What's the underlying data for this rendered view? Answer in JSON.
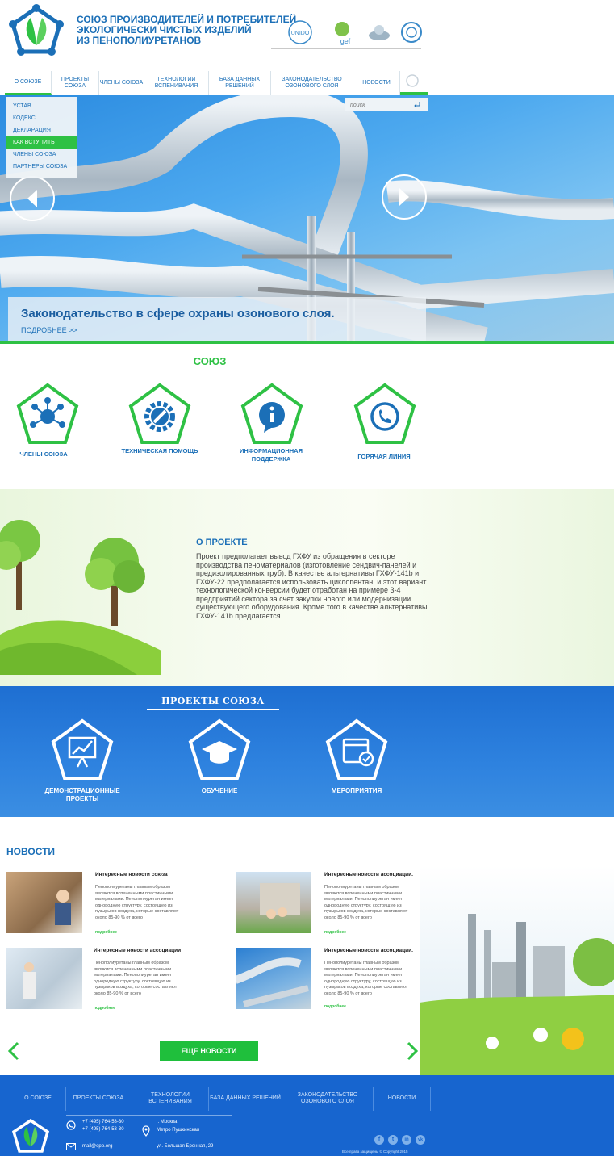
{
  "header": {
    "org_name_lines": [
      "СОЮЗ ПРОИЗВОДИТЕЛЕЙ И ПОТРЕБИТЕЛЕЙ",
      "ЭКОЛОГИЧЕСКИ ЧИСТЫХ ИЗДЕЛИЙ",
      "ИЗ ПЕНОПОЛИУРЕТАНОВ"
    ],
    "partners": [
      {
        "text": "UNIDO"
      },
      {
        "text": "gef"
      },
      {
        "text": ""
      },
      {
        "text": ""
      }
    ]
  },
  "nav": {
    "items": [
      {
        "label": "О СОЮЗЕ",
        "active": true
      },
      {
        "label": "ПРОЕКТЫ СОЮЗА"
      },
      {
        "label": "ЧЛЕНЫ СОЮЗА"
      },
      {
        "label": "ТЕХНОЛОГИИ ВСПЕНИВАНИЯ"
      },
      {
        "label": "БАЗА ДАННЫХ РЕШЕНИЙ"
      },
      {
        "label": "ЗАКОНОДАТЕЛЬСТВО ОЗОНОВОГО СЛОЯ"
      },
      {
        "label": "НОВОСТИ"
      }
    ],
    "dropdown": [
      "УСТАВ",
      "КОДЕКС",
      "ДЕКЛАРАЦИЯ",
      "КАК ВСТУПИТЬ",
      "ЧЛЕНЫ СОЮЗА",
      "ПАРТНЕРЫ СОЮЗА"
    ],
    "dropdown_active": "КАК ВСТУПИТЬ",
    "search_placeholder": "поиск"
  },
  "hero": {
    "caption_title": "Законодательство в сфере охраны озонового слоя.",
    "caption_more": "ПОДРОБНЕЕ >>"
  },
  "union": {
    "title": "СОЮЗ",
    "items": [
      {
        "label": "ЧЛЕНЫ СОЮЗА",
        "icon": "network-icon"
      },
      {
        "label": "ТЕХНИЧЕСКАЯ ПОМОЩЬ",
        "icon": "gear-wrench-icon"
      },
      {
        "label": "ИНФОРМАЦИОННАЯ ПОДДЕРЖКА",
        "icon": "info-icon"
      },
      {
        "label": "ГОРЯЧАЯ ЛИНИЯ",
        "icon": "phone-icon"
      }
    ]
  },
  "about": {
    "title": "О ПРОЕКТЕ",
    "text": "Проект предполагает вывод ГХФУ из обращения в секторе производства пеноматериалов (изготовление сендвич-панелей и предизолированных труб). В качестве альтернативы ГХФУ-141b и ГХФУ-22 предполагается использовать циклопентан, и этот вариант технологической конверсии будет отработан на примере 3-4 предприятий сектора за счет закупки нового или модернизации существующего оборудования. Кроме того в качестве альтернативы ГХФУ-141b предлагается"
  },
  "projects": {
    "title": "ПРОЕКТЫ СОЮЗА",
    "items": [
      {
        "label": "ДЕМОНСТРАЦИОННЫЕ ПРОЕКТЫ",
        "icon": "presentation-chart-icon"
      },
      {
        "label": "ОБУЧЕНИЕ",
        "icon": "graduation-cap-icon"
      },
      {
        "label": "МЕРОПРИЯТИЯ",
        "icon": "calendar-check-icon"
      }
    ]
  },
  "news": {
    "heading": "НОВОСТИ",
    "items": [
      {
        "title": "Интересные новости союза",
        "body": "Пенополиуретаны главным образом являются вспененными пластичными материалами. Пенополиуретан имеет однородную структуру, состоящую из пузырьков воздуха, которые составляют около 85-90 % от всего",
        "more": "подробнее"
      },
      {
        "title": "Интересные новости ассоциации.",
        "body": "Пенополиуретаны главным образом являются вспененными пластичными материалами. Пенополиуретан имеет однородную структуру, состоящую из пузырьков воздуха, которые составляют около 85-90 % от всего",
        "more": "подробнее"
      },
      {
        "title": "Интересные новости ассоциации",
        "body": "Пенополиуретаны главным образом являются вспененными пластичными материалами. Пенополиуретан имеет однородную структуру, состоящую из пузырьков воздуха, которые составляют около 85-90 % от всего",
        "more": "подробнее"
      },
      {
        "title": "Интересные новости ассоциации.",
        "body": "Пенополиуретаны главным образом являются вспененными пластичными материалами. Пенополиуретан имеет однородную структуру, состоящую из пузырьков воздуха, которые составляют около 85-90 % от всего",
        "more": "подробнее"
      }
    ],
    "more_button": "ЕЩЕ НОВОСТИ"
  },
  "footer": {
    "nav": [
      "О СОЮЗЕ",
      "ПРОЕКТЫ СОЮЗА",
      "ТЕХНОЛОГИИ ВСПЕНИВАНИЯ",
      "БАЗА ДАННЫХ РЕШЕНИЙ",
      "ЗАКОНОДАТЕЛЬСТВО ОЗОНОВОГО СЛОЯ",
      "НОВОСТИ"
    ],
    "phone1": "+7 (495) 764-53-30",
    "phone2": "+7 (495) 764-53-30",
    "email": "mail@opp.org",
    "city": "г. Москва",
    "metro": "Метро Пушкинская",
    "street": "ул. Большая Бронная, 29",
    "social": [
      "f",
      "t",
      "in",
      "vk"
    ],
    "copyright": "Все права защищены © Copyright 2015"
  },
  "colors": {
    "brand_blue": "#1b6fb7",
    "accent_green": "#2ec144",
    "footer_blue": "#1765cf"
  }
}
